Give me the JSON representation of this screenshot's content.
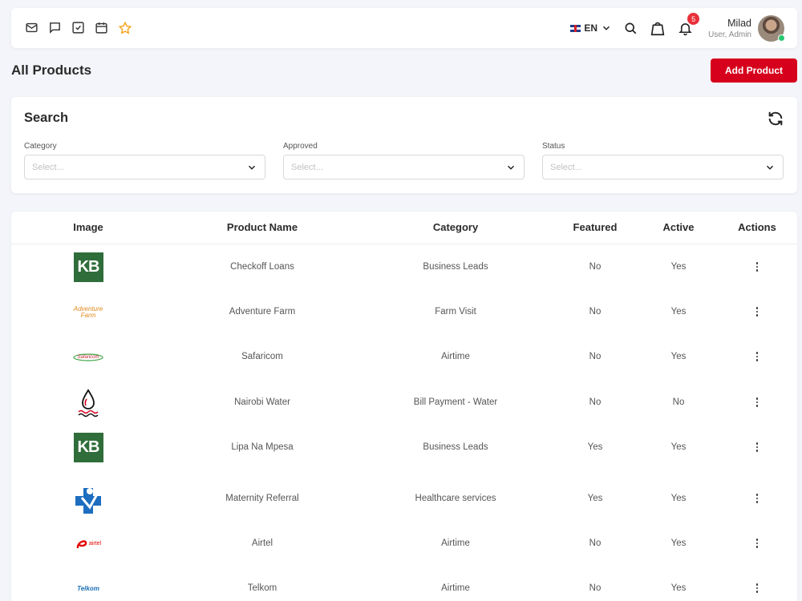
{
  "topbar": {
    "language": "EN",
    "notification_count": "5",
    "user_name": "Milad",
    "user_role": "User, Admin"
  },
  "page": {
    "title": "All Products",
    "add_button": "Add Product"
  },
  "search": {
    "title": "Search",
    "filters": [
      {
        "label": "Category",
        "placeholder": "Select..."
      },
      {
        "label": "Approved",
        "placeholder": "Select..."
      },
      {
        "label": "Status",
        "placeholder": "Select..."
      }
    ]
  },
  "table": {
    "headers": [
      "Image",
      "Product Name",
      "Category",
      "Featured",
      "Active",
      "Actions"
    ],
    "rows": [
      {
        "logo": "kb-logo",
        "logo_text": "KB",
        "name": "Checkoff Loans",
        "category": "Business Leads",
        "featured": "No",
        "active": "Yes"
      },
      {
        "logo": "adventure-farm-logo",
        "logo_text": "Adventure Farm",
        "name": "Adventure Farm",
        "category": "Farm Visit",
        "featured": "No",
        "active": "Yes"
      },
      {
        "logo": "safaricom-logo",
        "logo_text": "Safaricom",
        "name": "Safaricom",
        "category": "Airtime",
        "featured": "No",
        "active": "Yes"
      },
      {
        "logo": "water-drop-logo",
        "logo_text": "",
        "name": "Nairobi Water",
        "category": "Bill Payment - Water",
        "featured": "No",
        "active": "No"
      },
      {
        "logo": "kb-logo",
        "logo_text": "KB",
        "name": "Lipa Na Mpesa",
        "category": "Business Leads",
        "featured": "Yes",
        "active": "Yes"
      },
      {
        "logo": "medical-cross-logo",
        "logo_text": "",
        "name": "Maternity Referral",
        "category": "Healthcare services",
        "featured": "Yes",
        "active": "Yes"
      },
      {
        "logo": "airtel-logo",
        "logo_text": "airtel",
        "name": "Airtel",
        "category": "Airtime",
        "featured": "No",
        "active": "Yes"
      },
      {
        "logo": "telkom-logo",
        "logo_text": "Telkom",
        "name": "Telkom",
        "category": "Airtime",
        "featured": "No",
        "active": "Yes"
      }
    ]
  },
  "colors": {
    "accent": "#d6001c",
    "badge": "#e9313a",
    "star": "#f5a623",
    "online": "#28c76f",
    "kb_green": "#2f6d3a"
  }
}
